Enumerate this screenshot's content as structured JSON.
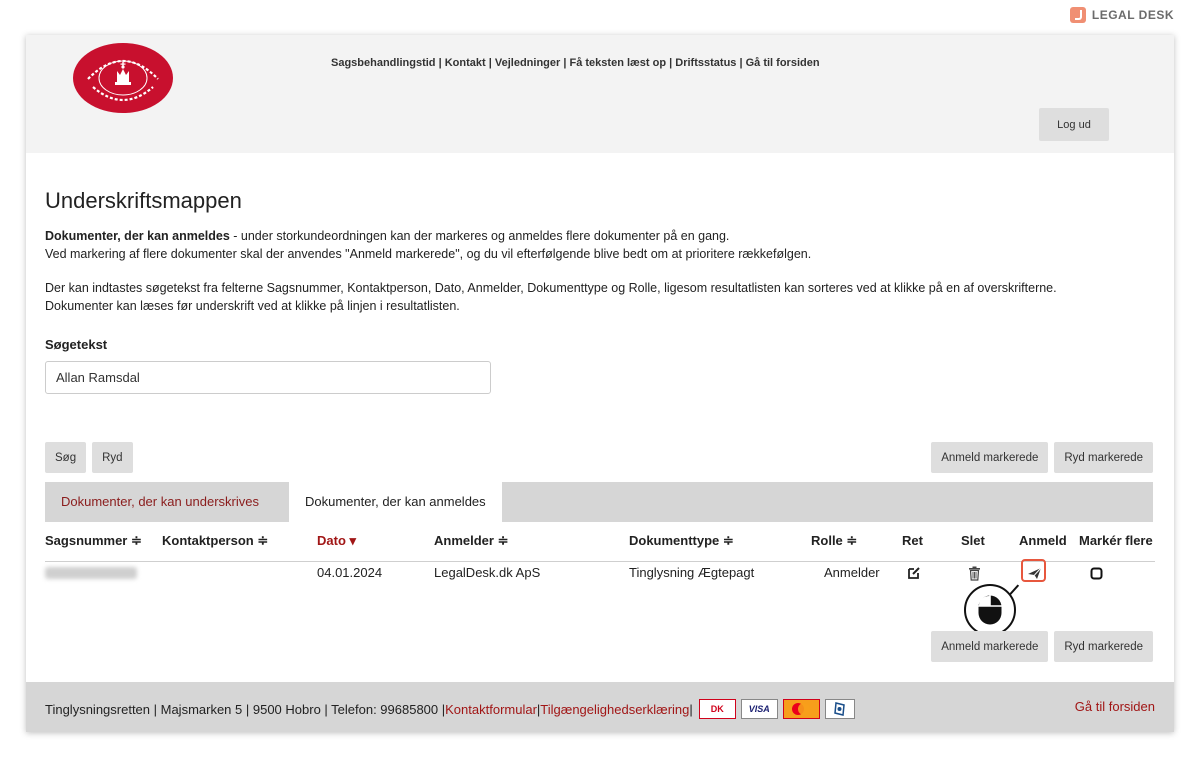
{
  "brand": {
    "name": "LEGAL DESK"
  },
  "header": {
    "nav": [
      "Sagsbehandlingstid",
      "Kontakt",
      "Vejledninger",
      "Få teksten læst op",
      "Driftsstatus",
      "Gå til forsiden"
    ],
    "logout": "Log ud"
  },
  "page": {
    "title": "Underskriftsmappen",
    "intro_bold": "Dokumenter, der kan anmeldes",
    "intro_rest": " - under storkundeordningen kan der markeres og anmeldes flere dokumenter på en gang.",
    "intro_line2": "Ved markering af flere dokumenter skal der anvendes \"Anmeld markerede\", og du vil efterfølgende blive bedt om at prioritere rækkefølgen.",
    "search_info": "Der kan indtastes søgetekst fra felterne Sagsnummer, Kontaktperson, Dato, Anmelder, Dokumenttype og Rolle, ligesom resultatlisten kan sorteres ved at klikke på en af overskrifterne.",
    "read_info": "Dokumenter kan læses før underskrift ved at klikke på linjen i resultatlisten."
  },
  "search": {
    "label": "Søgetekst",
    "value": "Allan Ramsdal",
    "search_button": "Søg",
    "clear_button": "Ryd"
  },
  "actions": {
    "anmeld_markerede": "Anmeld markerede",
    "ryd_markerede": "Ryd markerede"
  },
  "tabs": [
    {
      "label": "Dokumenter, der kan underskrives"
    },
    {
      "label": "Dokumenter, der kan anmeldes"
    }
  ],
  "table": {
    "headers": {
      "sagsnummer": "Sagsnummer ≑",
      "kontaktperson": "Kontaktperson ≑",
      "dato": "Dato ▾",
      "anmelder": "Anmelder ≑",
      "dokumenttype": "Dokumenttype ≑",
      "rolle": "Rolle ≑",
      "ret": "Ret",
      "slet": "Slet",
      "anmeld": "Anmeld",
      "marker": "Markér flere"
    },
    "rows": [
      {
        "sagsnummer": "",
        "kontaktperson": "",
        "dato": "04.01.2024",
        "anmelder": "LegalDesk.dk ApS",
        "dokumenttype": "Tinglysning Ægtepagt",
        "rolle": "Anmelder"
      }
    ]
  },
  "footer": {
    "address": "Tinglysningsretten | Majsmarken 5 | 9500 Hobro | Telefon: 99685800 | ",
    "contact_link": "Kontaktformular",
    "sep": " | ",
    "access_link": "Tilgængelighedserklæring",
    "sep2": " |",
    "home_link": "Gå til forsiden",
    "cards": [
      "DK",
      "VISA"
    ]
  },
  "colors": {
    "accent": "#a11616",
    "highlight": "#e7573e",
    "header_bg": "#f3f3f3",
    "footer_bg": "#d6d6d6"
  },
  "icons": [
    "edit-icon",
    "trash-icon",
    "send-icon",
    "checkbox-icon",
    "mouse-icon",
    "seal-logo"
  ]
}
